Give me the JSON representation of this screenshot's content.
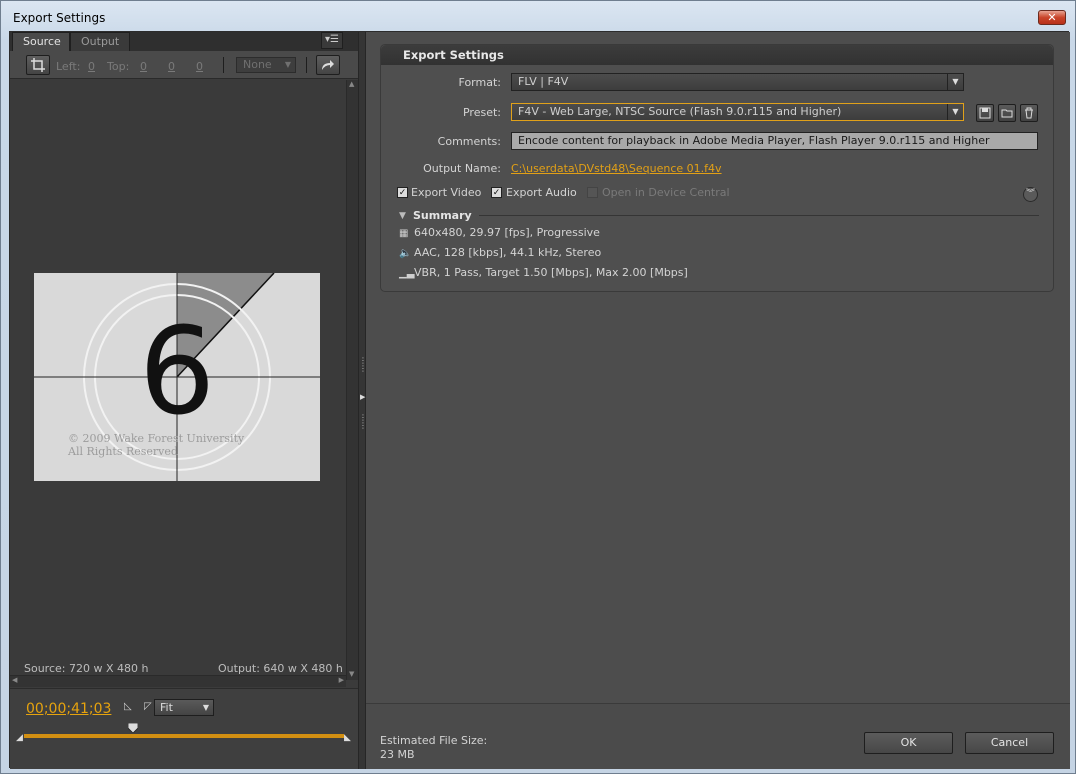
{
  "window": {
    "title": "Export Settings",
    "close_glyph": "✕"
  },
  "left_panel": {
    "tabs": [
      {
        "label": "Source"
      },
      {
        "label": "Output"
      }
    ],
    "crop": {
      "left_label": "Left:",
      "left_value": "0",
      "top_label": "Top:",
      "top_value": "0",
      "right_value": "0",
      "bottom_value": "0"
    },
    "aspect_select": "None",
    "source_size": "Source: 720 w X 480 h",
    "output_size": "Output: 640 w X 480 h",
    "preview": {
      "digit": "6",
      "copyright_line1": "© 2009 Wake Forest University",
      "copyright_line2": "All Rights Reserved"
    },
    "timecode": "00;00;41;03",
    "fit_select": "Fit"
  },
  "export_settings": {
    "header": "Export Settings",
    "format": {
      "label": "Format:",
      "value": "FLV | F4V"
    },
    "preset": {
      "label": "Preset:",
      "value": "F4V - Web Large, NTSC Source (Flash 9.0.r115 and Higher)"
    },
    "comments": {
      "label": "Comments:",
      "value": "Encode content for playback in Adobe Media Player, Flash Player 9.0.r115 and Higher"
    },
    "output_name": {
      "label": "Output Name:",
      "value": "C:\\userdata\\DVstd48\\Sequence 01.f4v"
    },
    "export_video": {
      "label": "Export Video",
      "checked": true
    },
    "export_audio": {
      "label": "Export Audio",
      "checked": true
    },
    "device_central": {
      "label": "Open in Device Central",
      "checked": false,
      "enabled": false
    },
    "summary": {
      "title": "Summary",
      "rows": [
        {
          "icon": "film-icon",
          "text": "640x480, 29.97 [fps], Progressive"
        },
        {
          "icon": "speaker-icon",
          "text": "AAC, 128 [kbps], 44.1 kHz, Stereo"
        },
        {
          "icon": "bitrate-icon",
          "text": "VBR, 1 Pass, Target 1.50 [Mbps], Max 2.00 [Mbps]"
        }
      ]
    }
  },
  "footer": {
    "estimated_label": "Estimated File Size:",
    "estimated_value": "23 MB",
    "ok_label": "OK",
    "cancel_label": "Cancel"
  },
  "colors": {
    "accent": "#e2a016",
    "panel": "#4d4d4d"
  }
}
